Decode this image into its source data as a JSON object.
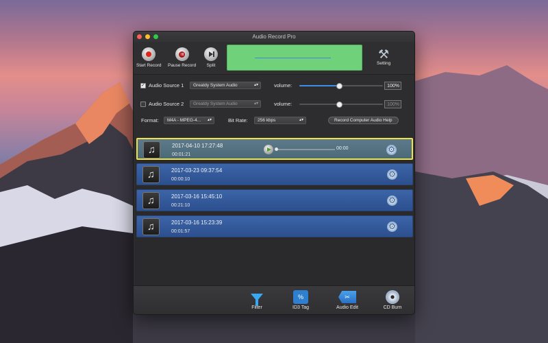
{
  "window": {
    "title": "Audio Record Pro"
  },
  "toolbar": {
    "start_label": "Start Record",
    "pause_label": "Pause Record",
    "split_label": "Split",
    "setting_label": "Setting"
  },
  "sources": [
    {
      "label": "Audio Source 1",
      "checked": true,
      "device": "Greatdy System Audio",
      "volume_label": "volume:",
      "volume": "100%",
      "volume_fraction": 1.0
    },
    {
      "label": "Audio Source 2",
      "checked": false,
      "device": "Greatdy System Audio",
      "volume_label": "volume:",
      "volume": "100%",
      "volume_fraction": 1.0
    }
  ],
  "format": {
    "label": "Format:",
    "value": "M4A - MPEG-4..."
  },
  "bitrate": {
    "label": "Bit Rate:",
    "value": "256 kbps"
  },
  "help_button": "Record Computer Audio Help",
  "recordings": [
    {
      "date": "2017-04-10 17:27:48",
      "duration": "00:01:21",
      "selected": true,
      "player_time": "00:00"
    },
    {
      "date": "2017-03-23 09:37:54",
      "duration": "00:00:10",
      "selected": false
    },
    {
      "date": "2017-03-16 15:45:10",
      "duration": "00:21:10",
      "selected": false
    },
    {
      "date": "2017-03-16 15:23:39",
      "duration": "00:01:57",
      "selected": false
    }
  ],
  "bottom": {
    "filter_label": "Filter",
    "id3_label": "ID3 Tag",
    "edit_label": "Audio Edit",
    "cd_label": "CD Burn"
  },
  "icons": {
    "start": "record-icon",
    "pause": "pause-icon",
    "split": "split-icon",
    "setting": "tools-icon",
    "thumb": "music-note-icon",
    "gear": "gear-icon",
    "filter": "funnel-icon",
    "id3": "tag-icon",
    "edit": "scissors-icon",
    "cd": "cd-icon"
  },
  "colors": {
    "waveform_bg": "#6fd27a",
    "list_item": "#2c4f8e",
    "selected_border": "#f2e24a",
    "accent": "#3d8ee5"
  }
}
